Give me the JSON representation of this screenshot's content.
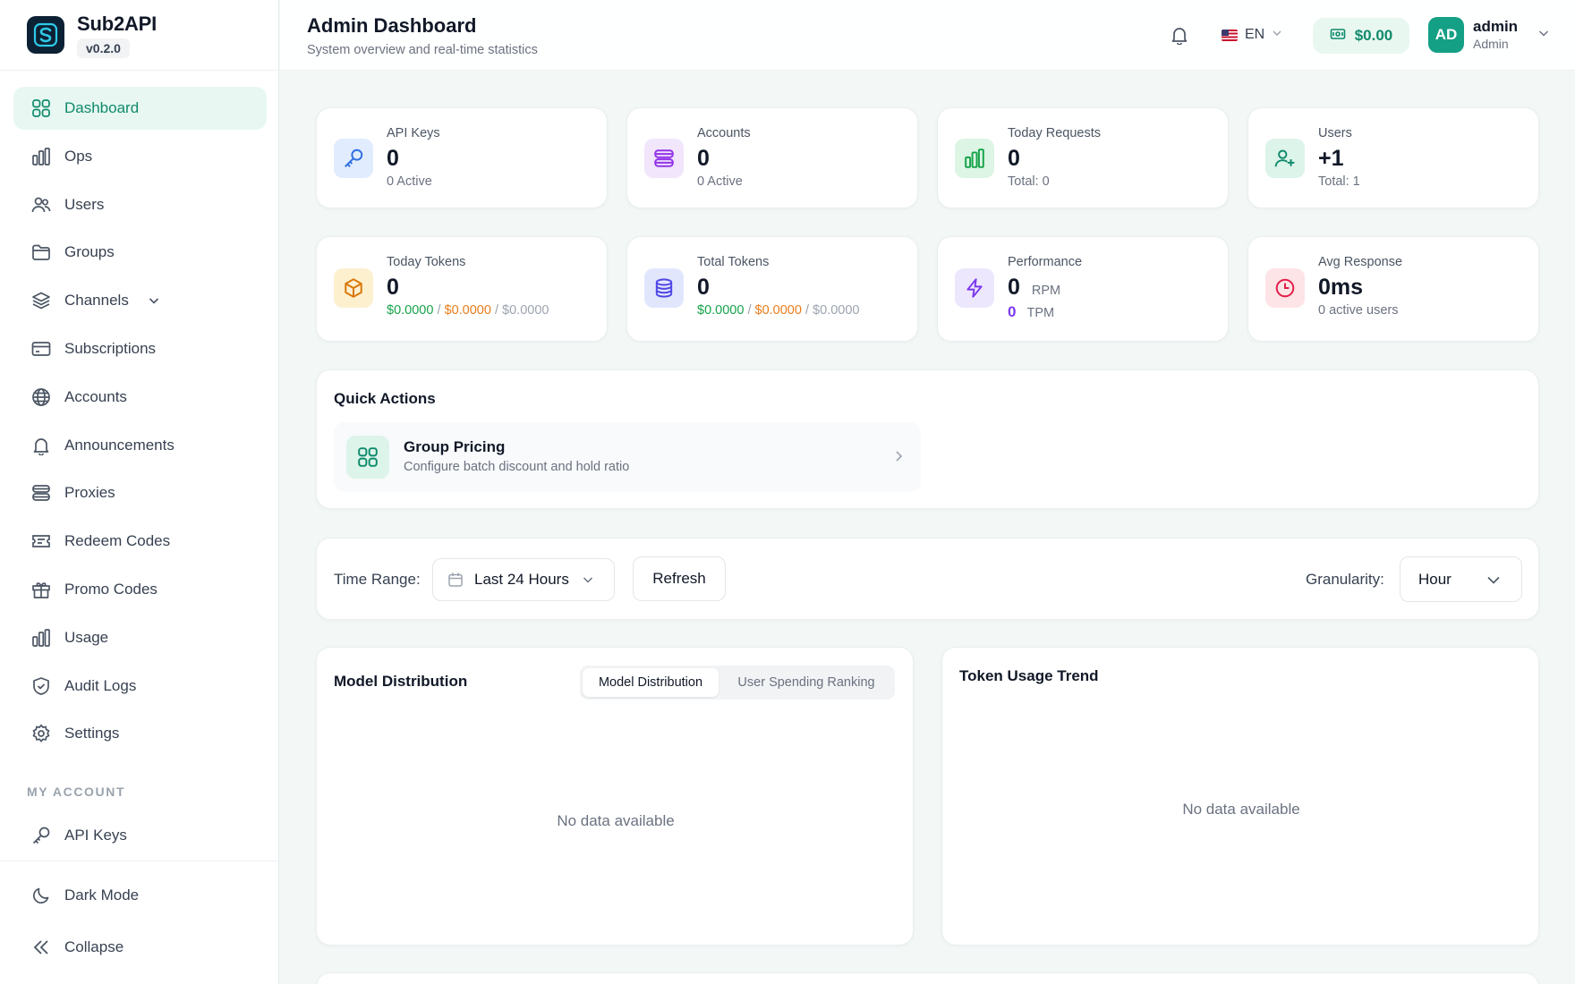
{
  "brand": {
    "name": "Sub2API",
    "version": "v0.2.0"
  },
  "sidebar": {
    "items": [
      {
        "label": "Dashboard",
        "icon": "dashboard-icon"
      },
      {
        "label": "Ops",
        "icon": "bar-chart-icon"
      },
      {
        "label": "Users",
        "icon": "users-icon"
      },
      {
        "label": "Groups",
        "icon": "folder-icon"
      },
      {
        "label": "Channels",
        "icon": "layers-icon"
      },
      {
        "label": "Subscriptions",
        "icon": "credit-card-icon"
      },
      {
        "label": "Accounts",
        "icon": "globe-icon"
      },
      {
        "label": "Announcements",
        "icon": "bell-icon"
      },
      {
        "label": "Proxies",
        "icon": "server-icon"
      },
      {
        "label": "Redeem Codes",
        "icon": "ticket-icon"
      },
      {
        "label": "Promo Codes",
        "icon": "gift-icon"
      },
      {
        "label": "Usage",
        "icon": "bar-chart-icon"
      },
      {
        "label": "Audit Logs",
        "icon": "shield-icon"
      },
      {
        "label": "Settings",
        "icon": "gear-icon"
      }
    ],
    "my_account_label": "MY ACCOUNT",
    "my_account_items": [
      {
        "label": "API Keys",
        "icon": "key-icon"
      }
    ],
    "bottom_items": [
      {
        "label": "Dark Mode",
        "icon": "moon-icon"
      },
      {
        "label": "Collapse",
        "icon": "double-chevron-left-icon"
      }
    ]
  },
  "header": {
    "title": "Admin Dashboard",
    "subtitle": "System overview and real-time statistics",
    "language": "EN",
    "balance": "$0.00",
    "user": {
      "initials": "AD",
      "name": "admin",
      "role": "Admin"
    }
  },
  "stats": {
    "api_keys": {
      "label": "API Keys",
      "value": "0",
      "sub": "0 Active"
    },
    "accounts": {
      "label": "Accounts",
      "value": "0",
      "sub": "0 Active"
    },
    "today_requests": {
      "label": "Today Requests",
      "value": "0",
      "sub": "Total: 0"
    },
    "users": {
      "label": "Users",
      "value": "+1",
      "sub": "Total: 1"
    },
    "today_tokens": {
      "label": "Today Tokens",
      "value": "0",
      "cost_a": "$0.0000",
      "cost_b": "$0.0000",
      "cost_c": "$0.0000",
      "sep": "/"
    },
    "total_tokens": {
      "label": "Total Tokens",
      "value": "0",
      "cost_a": "$0.0000",
      "cost_b": "$0.0000",
      "cost_c": "$0.0000",
      "sep": "/"
    },
    "performance": {
      "label": "Performance",
      "rpm_value": "0",
      "rpm_unit": "RPM",
      "tpm_value": "0",
      "tpm_unit": "TPM"
    },
    "avg_response": {
      "label": "Avg Response",
      "value": "0ms",
      "sub": "0 active users"
    }
  },
  "quick_actions": {
    "title": "Quick Actions",
    "items": [
      {
        "name": "Group Pricing",
        "desc": "Configure batch discount and hold ratio"
      }
    ]
  },
  "filters": {
    "time_range_label": "Time Range:",
    "time_range_value": "Last 24 Hours",
    "refresh_label": "Refresh",
    "granularity_label": "Granularity:",
    "granularity_value": "Hour"
  },
  "model_distribution": {
    "title": "Model Distribution",
    "tabs": [
      "Model Distribution",
      "User Spending Ranking"
    ],
    "active_tab": "Model Distribution",
    "empty": "No data available"
  },
  "token_trend": {
    "title": "Token Usage Trend",
    "empty": "No data available"
  },
  "colors": {
    "accent": "#0f8a6b",
    "active_bg": "#e8f7f2",
    "green": "#16a34a",
    "orange": "#ea7c1c",
    "purple": "#7c3aed"
  }
}
